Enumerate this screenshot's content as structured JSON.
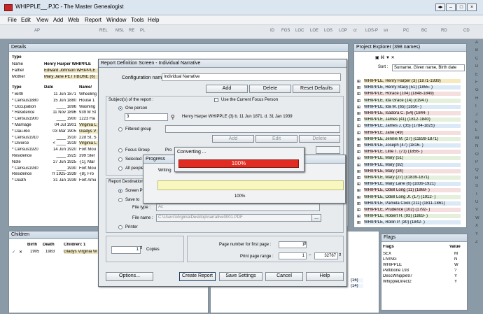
{
  "window": {
    "title": "WHIPPLE__.PJC - The Master Genealogist",
    "buttons": [
      "◂▸",
      "–",
      "□",
      "×"
    ]
  },
  "menu": [
    "File",
    "Edit",
    "View",
    "Add",
    "Web",
    "Report",
    "Window",
    "Tools",
    "Help"
  ],
  "toolbar": [
    "AP",
    "REL",
    "MSL",
    "RE",
    "PL",
    "ID",
    "FGS",
    "LOC",
    "LOE",
    "LOS",
    "LOP",
    "cr",
    "LOS-P",
    "sn",
    "PC",
    "BC",
    "RD",
    "CD"
  ],
  "details": {
    "title": "Details",
    "headers": [
      "Type",
      "Name",
      "Value"
    ],
    "person": [
      {
        "type": "Name",
        "name": "Henry Harper WHIPPLE"
      },
      {
        "type": "Father",
        "name": "Edward Johnson WHIPPLE"
      },
      {
        "type": "Mother",
        "name": "Mary Jane PETTIBONE (6)"
      }
    ],
    "event_headers": [
      "Type",
      "Date",
      "Name/"
    ],
    "events": [
      {
        "type": "* Birth",
        "date": "11 Jun 1871",
        "place": "Wheeling"
      },
      {
        "type": "* Census1880",
        "date": "15 Jun 1880",
        "place": "House 1"
      },
      {
        "type": "* Occupation",
        "date": "____ 1896",
        "place": "Washing"
      },
      {
        "type": "* Residence",
        "date": "11 Nov 1896",
        "place": "939 M St"
      },
      {
        "type": "* Census1900",
        "date": "____ 1900",
        "place": "1223 Ha"
      },
      {
        "type": "* Marriage",
        "date": "04 Jul 1901",
        "place": "Virginia L"
      },
      {
        "type": "* Dau-Bio",
        "date": "03 Mar 1905",
        "place": "Gladys V"
      },
      {
        "type": "* Census1910",
        "date": "____ 1910",
        "place": "22d St, S"
      },
      {
        "type": "* Divorce",
        "date": "< ____ 1919",
        "place": "Virginia L"
      },
      {
        "type": "* Census1920",
        "date": "14 Jun 1920",
        "place": "Fort Mou"
      },
      {
        "type": "Residence",
        "date": "____ 1925",
        "place": "399 Ster"
      },
      {
        "type": "Note",
        "date": "27 Jun 1925",
        "place": "-[1], Mar"
      },
      {
        "type": "* Census1930",
        "date": "____ 1930",
        "place": "Fort Mou"
      },
      {
        "type": "Residence",
        "date": "fr 1925-1939",
        "place": "-[8], Fro"
      },
      {
        "type": "* Death",
        "date": "31 Jan 1939",
        "place": "Fort Amu"
      }
    ]
  },
  "children": {
    "title": "Children",
    "headers": [
      "Birth",
      "Death",
      "Children: 1"
    ],
    "rows": [
      {
        "birth": "1905",
        "death": "1983",
        "name": "Gladys Virginia W"
      }
    ],
    "mid_cells": [
      "(16)",
      "(14)"
    ]
  },
  "dialog": {
    "title": "Report Definition Screen - Individual Narrative",
    "config_label": "Configuration name",
    "config_value": "Individual Narrative",
    "add": "Add",
    "delete": "Delete",
    "reset": "Reset Defaults",
    "subjects_label": "Subject(s) of the report :",
    "use_current": "Use the Current Focus Person",
    "one_person": "One person",
    "person_id": "3",
    "person_desc": "Henry Harper WHIPPLE (3) b. 11 Jun 1871, d. 31 Jan 1939",
    "filtered_group": "Filtered group",
    "add2": "Add",
    "edit": "Edit",
    "delete2": "Delete",
    "focus_group": "Focus Group",
    "focus_prefix": "Pro",
    "selected": "Selected",
    "all_people": "All people",
    "destination_label": "Report Destination",
    "screen_preview": "Screen Pr",
    "save_to": "Save to",
    "file_type_label": "File type :",
    "file_type_value": "Ac",
    "file_name_label": "File name :",
    "file_name_value": "C:\\Users\\Virginia\\Desktop\\narrative0001.PDF",
    "browse": "...",
    "printer": "Printer",
    "copies_value": "1",
    "copies_label": "Copies",
    "first_page_label": "Page number for first page :",
    "first_page_value": "1",
    "print_range_label": "Print page range :",
    "range_from": "1",
    "range_to": "32767",
    "options": "Options...",
    "create_report": "Create Report",
    "save_settings": "Save Settings",
    "cancel": "Cancel",
    "help": "Help"
  },
  "progress": {
    "title": "Progress",
    "writing": "Writing",
    "percent": "100%"
  },
  "converting": {
    "title": "Converting ...",
    "percent": "100%"
  },
  "explorer": {
    "title": "Project Explorer (398 names)",
    "sort_label": "Sort :",
    "sort_value": "Surname, Given name, Birth date",
    "rows": [
      "WHIPPLE, Henry Harper (3) (1871-1939)",
      "WHIPPLE, Henry Stacy (51) (1855- )",
      "WHIPPLE, Horace (104) (1848-1849)",
      "WHIPPLE, Ida Grace (14) (c1947)",
      "WHIPPLE, Ida M. (65) (1850- )",
      "WHIPPLE, Isadora C. (54) (1844- )",
      "WHIPPLE, James (41) (1812-1840)",
      "WHIPPLE, James J. (35) (1784-1825)",
      "WHIPPLE, Jane (49)",
      "WHIPPLE, Jennie M. (27) (c1839-1871)",
      "WHIPPLE, Joseph (47) (1816- )",
      "WHIPPLE, Lillie T. (71) (1856- )",
      "WHIPPLE, Mary (51)",
      "WHIPPLE, Mary (92)",
      "WHIPPLE, Mary (34)",
      "WHIPPLE, Mary (27) (c1839-1871)",
      "WHIPPLE, Mary Lane (6) (1839-1921)",
      "WHIPPLE, Odell Long (11) (1869- )",
      "WHIPPLE, Odell Long Jr. (17) (1912- )",
      "WHIPPLE, Pamela Cook (211) (1811-1861)",
      "WHIPPLE, Prudence (102) (1792- )",
      "WHIPPLE, Robert H. (93) (1883- )",
      "WHIPPLE, Rollin P. (30) (1842- )"
    ]
  },
  "flags": {
    "title": "Flags",
    "headers": [
      "Flags",
      "Value"
    ],
    "rows": [
      {
        "name": "SEX",
        "value": "M"
      },
      {
        "name": "LIVING",
        "value": "N"
      },
      {
        "name": "WHIPPLE",
        "value": "W"
      },
      {
        "name": "Pettibone 193",
        "value": "?"
      },
      {
        "name": "DescWhipple97",
        "value": "Y"
      },
      {
        "name": "WhippleDirect2",
        "value": "Y"
      }
    ]
  },
  "scroll_letters": [
    "A",
    "B",
    "C",
    "D",
    "E",
    "F",
    "G",
    "H",
    "I",
    "J",
    "K",
    "L",
    "M",
    "N",
    "O",
    "P",
    "Q",
    "R",
    "S",
    "T",
    "U",
    "V",
    "W",
    "X",
    "Y",
    "Z"
  ]
}
